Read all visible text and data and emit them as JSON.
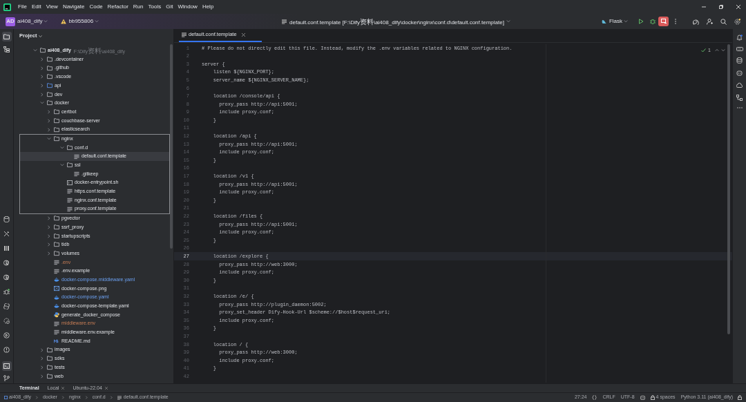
{
  "menu": [
    "File",
    "Edit",
    "View",
    "Navigate",
    "Code",
    "Refactor",
    "Run",
    "Tools",
    "Git",
    "Window",
    "Help"
  ],
  "toolbar": {
    "project_badge": "AD",
    "project": "ai408_dify",
    "branch": "bb955806",
    "title": "default.conf.template [F:\\Dify资料\\ai408_dify\\docker\\nginx\\conf.d\\default.conf.template]",
    "run_config": "Flask"
  },
  "project": {
    "title": "Project",
    "tree": [
      {
        "name": "ai408_dify",
        "hint": "F:\\Dify资料\\ai408_dify",
        "kind": "folder",
        "expanded": true,
        "children": [
          {
            "name": ".devcontainer",
            "kind": "folder",
            "expanded": false
          },
          {
            "name": ".github",
            "kind": "folder",
            "expanded": false
          },
          {
            "name": ".vscode",
            "kind": "folder",
            "expanded": false
          },
          {
            "name": "api",
            "kind": "module",
            "expanded": false
          },
          {
            "name": "dev",
            "kind": "folder",
            "expanded": false
          },
          {
            "name": "docker",
            "kind": "folder",
            "expanded": true,
            "children": [
              {
                "name": "certbot",
                "kind": "folder",
                "expanded": false
              },
              {
                "name": "couchbase-server",
                "kind": "folder",
                "expanded": false
              },
              {
                "name": "elasticsearch",
                "kind": "folder",
                "expanded": false
              },
              {
                "name": "nginx",
                "kind": "folder",
                "expanded": true,
                "highlighted": true,
                "children": [
                  {
                    "name": "conf.d",
                    "kind": "folder",
                    "expanded": true,
                    "children": [
                      {
                        "name": "default.conf.template",
                        "kind": "text",
                        "selected": true
                      }
                    ]
                  },
                  {
                    "name": "ssl",
                    "kind": "folder",
                    "expanded": true,
                    "children": [
                      {
                        "name": ".gitkeep",
                        "kind": "text",
                        "selected": false
                      }
                    ]
                  },
                  {
                    "name": "docker-entrypoint.sh",
                    "kind": "shell",
                    "selected": false
                  },
                  {
                    "name": "https.conf.template",
                    "kind": "text",
                    "selected": false
                  },
                  {
                    "name": "nginx.conf.template",
                    "kind": "text",
                    "selected": false
                  },
                  {
                    "name": "proxy.conf.template",
                    "kind": "text",
                    "selected": false
                  }
                ]
              },
              {
                "name": "pgvector",
                "kind": "folder",
                "expanded": false
              },
              {
                "name": "ssrf_proxy",
                "kind": "folder",
                "expanded": false
              },
              {
                "name": "startupscripts",
                "kind": "folder",
                "expanded": false
              },
              {
                "name": "tidb",
                "kind": "folder",
                "expanded": false
              },
              {
                "name": "volumes",
                "kind": "folder",
                "expanded": false
              },
              {
                "name": ".env",
                "kind": "text",
                "selected": false,
                "ignored": true
              },
              {
                "name": ".env.example",
                "kind": "text",
                "selected": false
              },
              {
                "name": "docker-compose.middleware.yaml",
                "kind": "docker",
                "selected": false,
                "modified": true
              },
              {
                "name": "docker-compose.png",
                "kind": "image",
                "selected": false
              },
              {
                "name": "docker-compose.yaml",
                "kind": "docker",
                "selected": false,
                "modified": true
              },
              {
                "name": "docker-compose-template.yaml",
                "kind": "docker",
                "selected": false
              },
              {
                "name": "generate_docker_compose",
                "kind": "python",
                "selected": false
              },
              {
                "name": "middleware.env",
                "kind": "text",
                "selected": false,
                "ignored": true
              },
              {
                "name": "middleware.env.example",
                "kind": "text",
                "selected": false
              },
              {
                "name": "README.md",
                "kind": "markdown",
                "selected": false
              }
            ]
          },
          {
            "name": "images",
            "kind": "folder",
            "expanded": false
          },
          {
            "name": "sdks",
            "kind": "folder",
            "expanded": false
          },
          {
            "name": "tests",
            "kind": "folder",
            "expanded": false
          },
          {
            "name": "web",
            "kind": "folder",
            "expanded": false
          }
        ]
      }
    ]
  },
  "editor": {
    "tab": "default.conf.template",
    "problems": "1",
    "lines": [
      {
        "n": "1",
        "text": "# Please do not directly edit this file. Instead, modify the .env variables related to NGINX configuration.",
        "current": false
      },
      {
        "n": "2",
        "current": false
      },
      {
        "n": "3",
        "text": "server {",
        "current": false
      },
      {
        "n": "4",
        "text": "    listen ${NGINX_PORT};",
        "current": false
      },
      {
        "n": "5",
        "text": "    server_name ${NGINX_SERVER_NAME};",
        "current": false
      },
      {
        "n": "6",
        "current": false
      },
      {
        "n": "7",
        "text": "    location /console/api {",
        "current": false
      },
      {
        "n": "8",
        "text": "      proxy_pass http://api:5001;",
        "current": false
      },
      {
        "n": "9",
        "text": "      include proxy.conf;",
        "current": false
      },
      {
        "n": "10",
        "text": "    }",
        "current": false
      },
      {
        "n": "11",
        "current": false
      },
      {
        "n": "12",
        "text": "    location /api {",
        "current": false
      },
      {
        "n": "13",
        "text": "      proxy_pass http://api:5001;",
        "current": false
      },
      {
        "n": "14",
        "text": "      include proxy.conf;",
        "current": false
      },
      {
        "n": "15",
        "text": "    }",
        "current": false
      },
      {
        "n": "16",
        "current": false
      },
      {
        "n": "17",
        "text": "    location /v1 {",
        "current": false
      },
      {
        "n": "18",
        "text": "      proxy_pass http://api:5001;",
        "current": false
      },
      {
        "n": "19",
        "text": "      include proxy.conf;",
        "current": false
      },
      {
        "n": "20",
        "text": "    }",
        "current": false
      },
      {
        "n": "21",
        "current": false
      },
      {
        "n": "22",
        "text": "    location /files {",
        "current": false
      },
      {
        "n": "23",
        "text": "      proxy_pass http://api:5001;",
        "current": false
      },
      {
        "n": "24",
        "text": "      include proxy.conf;",
        "current": false
      },
      {
        "n": "25",
        "text": "    }",
        "current": false
      },
      {
        "n": "26",
        "current": false
      },
      {
        "n": "27",
        "text": "    location /explore {",
        "current": true
      },
      {
        "n": "28",
        "text": "      proxy_pass http://web:3000;",
        "current": false
      },
      {
        "n": "29",
        "text": "      include proxy.conf;",
        "current": false
      },
      {
        "n": "30",
        "text": "    }",
        "current": false
      },
      {
        "n": "31",
        "current": false
      },
      {
        "n": "32",
        "text": "    location /e/ {",
        "current": false
      },
      {
        "n": "33",
        "text": "      proxy_pass http://plugin_daemon:5002;",
        "current": false
      },
      {
        "n": "34",
        "text": "      proxy_set_header Dify-Hook-Url $scheme://$host$request_uri;",
        "current": false
      },
      {
        "n": "35",
        "text": "      include proxy.conf;",
        "current": false
      },
      {
        "n": "36",
        "text": "    }",
        "current": false
      },
      {
        "n": "37",
        "current": false
      },
      {
        "n": "38",
        "text": "    location / {",
        "current": false
      },
      {
        "n": "39",
        "text": "      proxy_pass http://web:3000;",
        "current": false
      },
      {
        "n": "40",
        "text": "      include proxy.conf;",
        "current": false
      },
      {
        "n": "41",
        "text": "    }",
        "current": false
      },
      {
        "n": "42",
        "current": false
      }
    ]
  },
  "terminal_tabs": [
    {
      "label": "Terminal",
      "selected": true,
      "closable": false
    },
    {
      "label": "Local",
      "selected": false,
      "closable": true
    },
    {
      "label": "Ubuntu-22.04",
      "selected": false,
      "closable": true
    }
  ],
  "breadcrumb": [
    "ai408_dify",
    "docker",
    "nginx",
    "conf.d",
    "default.conf.template"
  ],
  "status_bar": {
    "position": "27:24",
    "line_separator": "CRLF",
    "encoding": "UTF-8",
    "indent": "4 spaces",
    "interpreter": "Python 3.11 (ai408_dify)"
  }
}
